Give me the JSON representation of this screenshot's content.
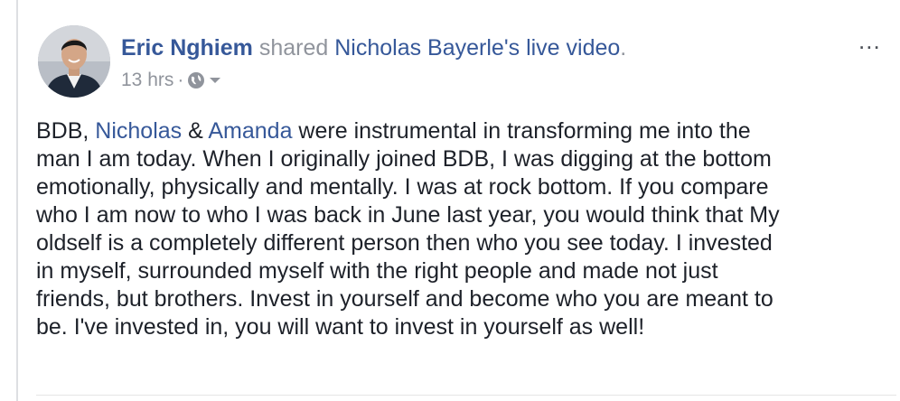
{
  "post": {
    "actor_name": "Eric Nghiem",
    "shared_text": "shared",
    "source_name": "Nicholas Bayerle",
    "source_suffix": "'s",
    "content_type": "live video",
    "period": ".",
    "timestamp": "13 hrs",
    "dot": "·",
    "privacy_icon": "globe-icon",
    "more_label": "...",
    "body": {
      "part1": "BDB, ",
      "mention1": "Nicholas",
      "part2": " & ",
      "mention2": "Amanda",
      "line1_rest": " were instrumental in transforming me into the",
      "line2": "man I am today. When I originally joined BDB, I was digging at the bottom",
      "line3": "emotionally, physically and mentally. I was at rock bottom. If you compare",
      "line4": "who I am now to who I was back in June last year, you would think that My",
      "line5": "oldself is a completely different person then who you see today. I invested",
      "line6": "in myself, surrounded myself with the right people and made not just",
      "line7": "friends, but brothers. Invest in yourself and become who you are meant to",
      "line8": "be. I've invested in, you will want to invest in yourself as well!"
    }
  },
  "colors": {
    "link": "#365899",
    "muted": "#90949c",
    "text": "#1d2129"
  }
}
